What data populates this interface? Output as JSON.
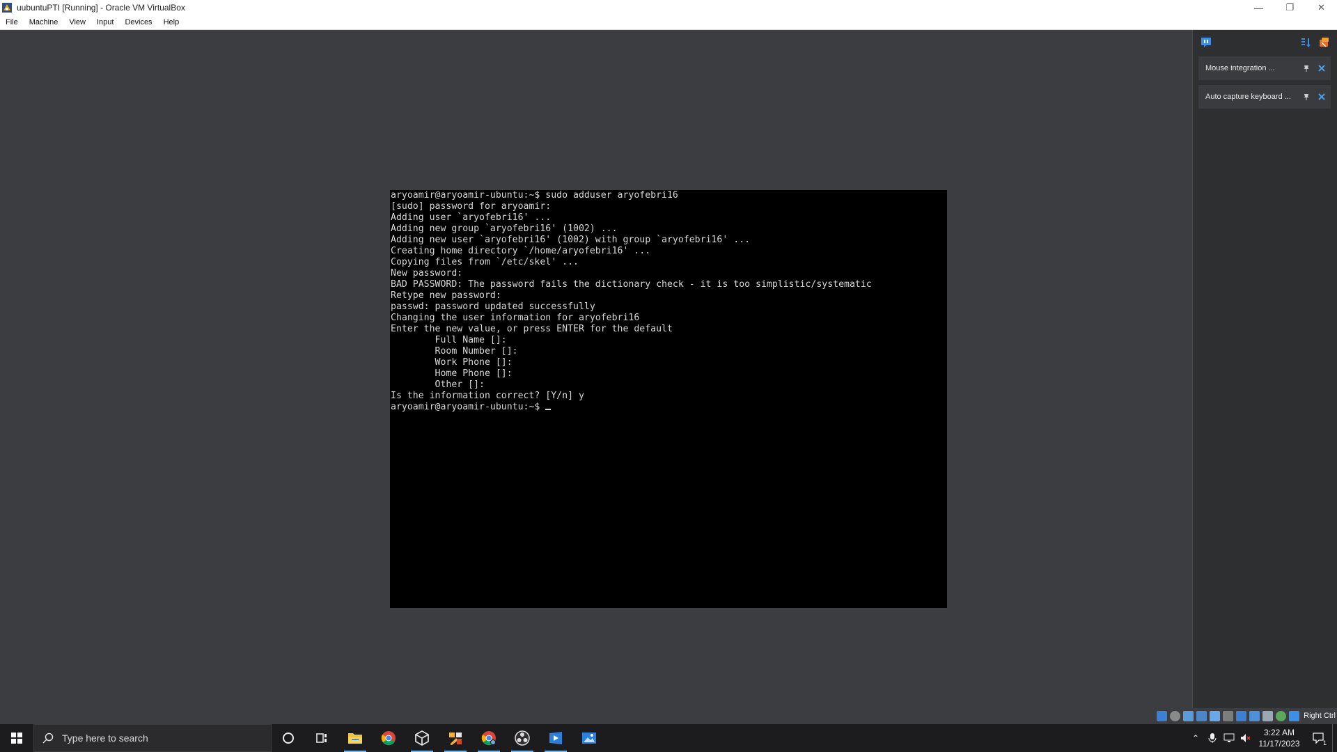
{
  "window": {
    "title": "uubuntuPTI [Running] - Oracle VM VirtualBox",
    "controls": [
      "minimize",
      "restore",
      "close"
    ]
  },
  "menu": [
    "File",
    "Machine",
    "View",
    "Input",
    "Devices",
    "Help"
  ],
  "terminal": {
    "lines": [
      "aryoamir@aryoamir-ubuntu:~$ sudo adduser aryofebri16",
      "[sudo] password for aryoamir:",
      "Adding user `aryofebri16' ...",
      "Adding new group `aryofebri16' (1002) ...",
      "Adding new user `aryofebri16' (1002) with group `aryofebri16' ...",
      "Creating home directory `/home/aryofebri16' ...",
      "Copying files from `/etc/skel' ...",
      "New password:",
      "BAD PASSWORD: The password fails the dictionary check - it is too simplistic/systematic",
      "Retype new password:",
      "passwd: password updated successfully",
      "Changing the user information for aryofebri16",
      "Enter the new value, or press ENTER for the default",
      "        Full Name []:",
      "        Room Number []:",
      "        Work Phone []:",
      "        Home Phone []:",
      "        Other []:",
      "Is the information correct? [Y/n] y"
    ],
    "prompt": "aryoamir@aryoamir-ubuntu:~$ "
  },
  "notifications": [
    {
      "label": "Mouse integration ..."
    },
    {
      "label": "Auto capture keyboard ..."
    }
  ],
  "statusbar": {
    "host_key": "Right Ctrl"
  },
  "taskbar": {
    "search_placeholder": "Type here to search",
    "apps": [
      "file-explorer",
      "chrome",
      "virtualbox",
      "code-editor",
      "chrome-alt",
      "obs",
      "media-player",
      "photos"
    ],
    "clock_time": "3:22 AM",
    "clock_date": "11/17/2023",
    "notification_count": "1"
  },
  "colors": {
    "vm_background": "#3c3d40",
    "terminal_bg": "#000000",
    "terminal_fg": "#d8d8d8",
    "taskbar_bg": "#1c1c1f",
    "accent": "#76b9ed"
  }
}
